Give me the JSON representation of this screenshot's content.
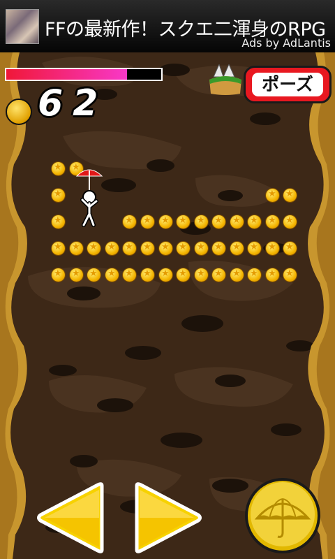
{
  "ad": {
    "title": "FFの最新作！スクエ二渾身のRPG",
    "credit": "Ads by AdLantis",
    "thumb_icon": "ad-thumbnail-image"
  },
  "hud": {
    "health_fraction": 0.78,
    "coin_count": "62",
    "coin_icon": "star-coin-icon",
    "pause_label": "ポーズ",
    "hazard_icon": "spiked-platform-icon"
  },
  "controls": {
    "left": "left-arrow-icon",
    "right": "right-arrow-icon",
    "umbrella": "umbrella-icon"
  },
  "colors": {
    "cave": "#3b2716",
    "wall": "#c8962e",
    "coin": "#f4b400",
    "pause": "#e81820",
    "arrow": "#f5c400"
  }
}
